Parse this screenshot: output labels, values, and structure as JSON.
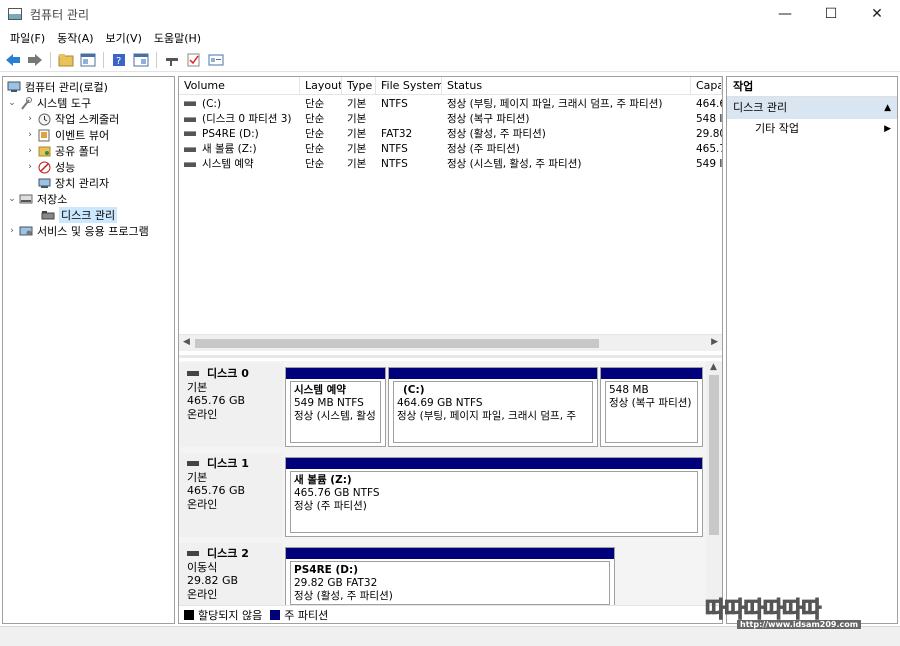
{
  "window": {
    "title": "컴퓨터 관리",
    "controls": {
      "minimize": "—",
      "maximize": "☐",
      "close": "✕"
    }
  },
  "menu": [
    "파일(F)",
    "동작(A)",
    "보기(V)",
    "도움말(H)"
  ],
  "toolbar": [
    "back-icon",
    "forward-icon",
    "folder-icon",
    "properties-icon",
    "help-icon",
    "console-icon",
    "connect-icon",
    "check-icon",
    "settings-icon"
  ],
  "tree": {
    "root": "컴퓨터 관리(로컬)",
    "system_tools": "시스템 도구",
    "task_scheduler": "작업 스케줄러",
    "event_viewer": "이벤트 뷰어",
    "shared_folders": "공유 폴더",
    "performance": "성능",
    "device_manager": "장치 관리자",
    "storage": "저장소",
    "disk_management": "디스크 관리",
    "services_apps": "서비스 및 응용 프로그램"
  },
  "table": {
    "headers": [
      "Volume",
      "Layout",
      "Type",
      "File System",
      "Status",
      "Capa"
    ],
    "rows": [
      [
        "(C:)",
        "단순",
        "기본",
        "NTFS",
        "정상 (부팅, 페이지 파일, 크래시 덤프, 주 파티션)",
        "464.6"
      ],
      [
        "(디스크 0 파티션 3)",
        "단순",
        "기본",
        "",
        "정상 (복구 파티션)",
        "548 I"
      ],
      [
        "PS4RE (D:)",
        "단순",
        "기본",
        "FAT32",
        "정상 (활성, 주 파티션)",
        "29.80"
      ],
      [
        "새 볼륨 (Z:)",
        "단순",
        "기본",
        "NTFS",
        "정상 (주 파티션)",
        "465.7"
      ],
      [
        "시스템 예약",
        "단순",
        "기본",
        "NTFS",
        "정상 (시스템, 활성, 주 파티션)",
        "549 I"
      ]
    ]
  },
  "disks": [
    {
      "name": "디스크 0",
      "type": "기본",
      "size": "465.76 GB",
      "state": "온라인",
      "partitions": [
        {
          "name": "시스템 예약",
          "size": "549 MB NTFS",
          "status": "정상 (시스템, 활성"
        },
        {
          "name": "(C:)",
          "size": "464.69 GB NTFS",
          "status": "정상 (부팅, 페이지 파일, 크래시 덤프, 주"
        },
        {
          "name": "",
          "size": "548 MB",
          "status": "정상 (복구 파티션)"
        }
      ]
    },
    {
      "name": "디스크 1",
      "type": "기본",
      "size": "465.76 GB",
      "state": "온라인",
      "partitions": [
        {
          "name": "새 볼륨  (Z:)",
          "size": "465.76 GB NTFS",
          "status": "정상 (주 파티션)"
        }
      ]
    },
    {
      "name": "디스크 2",
      "type": "이동식",
      "size": "29.82 GB",
      "state": "온라인",
      "partitions": [
        {
          "name": "PS4RE  (D:)",
          "size": "29.82 GB FAT32",
          "status": "정상 (활성, 주 파티션)"
        }
      ]
    }
  ],
  "legend": {
    "unallocated": "할당되지 않음",
    "primary": "주 파티션"
  },
  "actions": {
    "title": "작업",
    "section": "디스크 관리",
    "more": "기타 작업"
  },
  "watermark": {
    "big": "따따따따따따",
    "url": "http://www.idsam209.com"
  },
  "colors": {
    "partition_bar": "#00007b",
    "unallocated": "#000000",
    "selection": "#cce8ff",
    "actions_section": "#d9e6f2"
  }
}
